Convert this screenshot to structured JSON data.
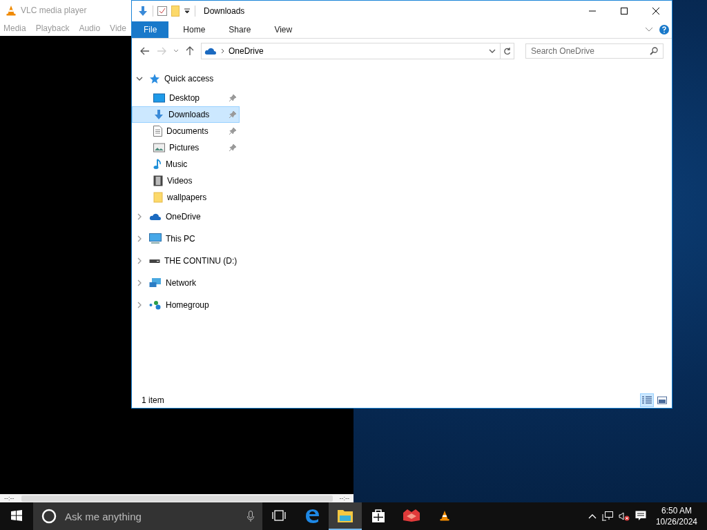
{
  "vlc": {
    "title": "VLC media player",
    "menu": [
      "Media",
      "Playback",
      "Audio",
      "Vide"
    ],
    "time_elapsed": "--:--",
    "time_total": "--:--"
  },
  "explorer": {
    "title": "Downloads",
    "ribbon_tabs": [
      {
        "label": "File",
        "selected": true
      },
      {
        "label": "Home",
        "selected": false
      },
      {
        "label": "Share",
        "selected": false
      },
      {
        "label": "View",
        "selected": false
      }
    ],
    "address": {
      "location": "OneDrive"
    },
    "search": {
      "placeholder": "Search OneDrive"
    },
    "nav_pane": [
      {
        "label": "Quick access",
        "kind": "star",
        "expanded": true,
        "selected": false,
        "children": [
          {
            "label": "Desktop",
            "kind": "desktop",
            "pinned": true,
            "selected": false
          },
          {
            "label": "Downloads",
            "kind": "download",
            "pinned": true,
            "selected": true
          },
          {
            "label": "Documents",
            "kind": "document",
            "pinned": true,
            "selected": false
          },
          {
            "label": "Pictures",
            "kind": "pictures",
            "pinned": true,
            "selected": false
          },
          {
            "label": "Music",
            "kind": "music",
            "pinned": false,
            "selected": false
          },
          {
            "label": "Videos",
            "kind": "videos",
            "pinned": false,
            "selected": false
          },
          {
            "label": "wallpapers",
            "kind": "folder",
            "pinned": false,
            "selected": false
          }
        ]
      },
      {
        "label": "OneDrive",
        "kind": "cloud",
        "expanded": false,
        "selected": false
      },
      {
        "label": "This PC",
        "kind": "pc",
        "expanded": false,
        "selected": false
      },
      {
        "label": "THE CONTINU (D:)",
        "kind": "drive",
        "expanded": false,
        "selected": false
      },
      {
        "label": "Network",
        "kind": "network",
        "expanded": false,
        "selected": false
      },
      {
        "label": "Homegroup",
        "kind": "homegroup",
        "expanded": false,
        "selected": false
      }
    ],
    "status_bar": {
      "item_count": "1 item",
      "views": [
        {
          "kind": "details",
          "selected": true
        },
        {
          "kind": "large_icons",
          "selected": false
        }
      ]
    }
  },
  "taskbar": {
    "search": {
      "placeholder": "Ask me anything"
    },
    "apps": [
      {
        "kind": "edge",
        "selected": false
      },
      {
        "kind": "explorer",
        "selected": true
      },
      {
        "kind": "store",
        "selected": false
      },
      {
        "kind": "red_app",
        "selected": false
      },
      {
        "kind": "vlc",
        "selected": false
      }
    ],
    "clock": {
      "time": "6:50 AM",
      "date": "10/26/2024"
    }
  }
}
